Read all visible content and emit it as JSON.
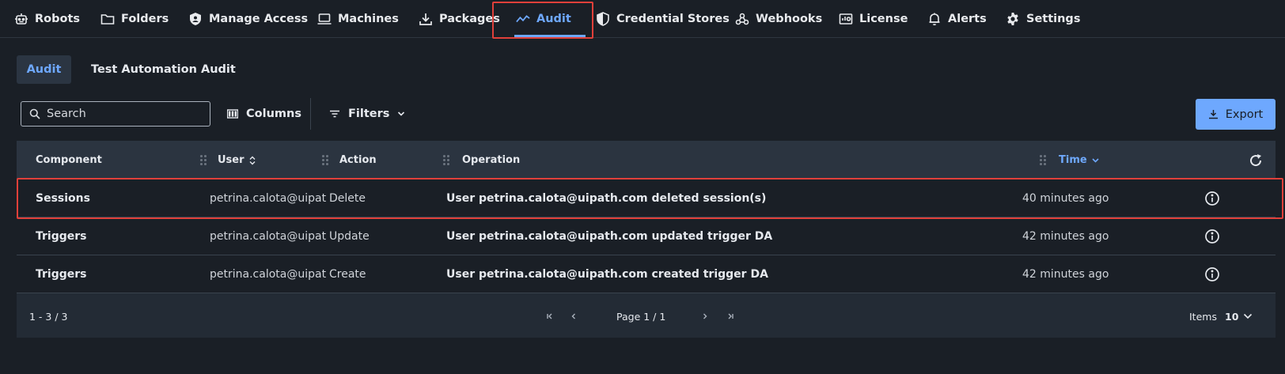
{
  "nav": {
    "items": [
      {
        "label": "Robots",
        "icon": "robot-icon"
      },
      {
        "label": "Folders",
        "icon": "folder-icon"
      },
      {
        "label": "Manage Access",
        "icon": "shield-icon"
      },
      {
        "label": "Machines",
        "icon": "laptop-icon"
      },
      {
        "label": "Packages",
        "icon": "download-icon"
      },
      {
        "label": "Audit",
        "icon": "chart-line-icon"
      },
      {
        "label": "Credential Stores",
        "icon": "shield-half-icon"
      },
      {
        "label": "Webhooks",
        "icon": "webhook-icon"
      },
      {
        "label": "License",
        "icon": "license-icon"
      },
      {
        "label": "Alerts",
        "icon": "bell-icon"
      },
      {
        "label": "Settings",
        "icon": "gear-icon"
      }
    ],
    "active": "Audit"
  },
  "subtabs": {
    "audit": "Audit",
    "test_automation_audit": "Test Automation Audit"
  },
  "toolbar": {
    "search_placeholder": "Search",
    "columns_label": "Columns",
    "filters_label": "Filters",
    "export_label": "Export"
  },
  "table": {
    "headers": {
      "component": "Component",
      "user": "User",
      "action": "Action",
      "operation": "Operation",
      "time": "Time"
    },
    "rows": [
      {
        "component": "Sessions",
        "user": "petrina.calota@uipat...",
        "action": "Delete",
        "operation": "User petrina.calota@uipath.com deleted session(s)",
        "time": "40 minutes ago"
      },
      {
        "component": "Triggers",
        "user": "petrina.calota@uipat...",
        "action": "Update",
        "operation": "User petrina.calota@uipath.com updated trigger DA",
        "time": "42 minutes ago"
      },
      {
        "component": "Triggers",
        "user": "petrina.calota@uipat...",
        "action": "Create",
        "operation": "User petrina.calota@uipath.com created trigger DA",
        "time": "42 minutes ago"
      }
    ]
  },
  "pagination": {
    "range": "1 - 3 / 3",
    "page": "Page 1 / 1",
    "items_label": "Items",
    "items_value": "10"
  },
  "colors": {
    "accent": "#6ea8fe",
    "highlight": "#e0403a",
    "background": "#1a1f26"
  }
}
